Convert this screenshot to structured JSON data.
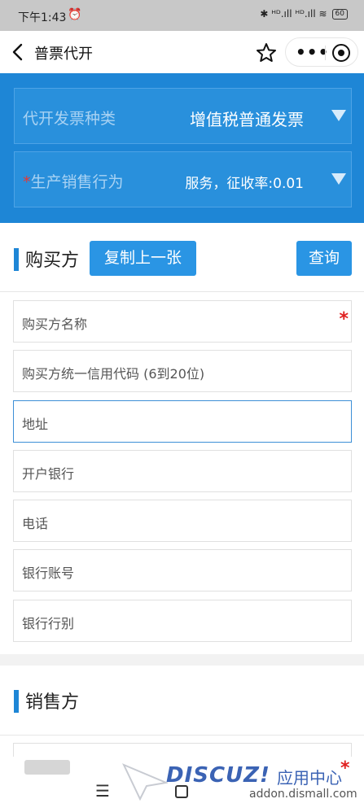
{
  "status_bar": {
    "time": "下午1:43",
    "alarm_icon": "alarm-clock-icon",
    "signals": "✱ ᴴᴰ.ıll ᴴᴰ.ıll ≋",
    "battery": "60"
  },
  "nav": {
    "title": "普票代开",
    "back_icon": "chevron-left-icon",
    "star_icon": "star-outline-icon",
    "more_label": "•••",
    "target_icon": "target-circle-icon"
  },
  "invoice_settings": {
    "type_label": "代开发票种类",
    "type_value": "增值税普通发票",
    "behavior_required": "*",
    "behavior_label": "生产销售行为",
    "behavior_value": "服务，征收率:0.01"
  },
  "buyer": {
    "title": "购买方",
    "copy_button": "复制上一张",
    "query_button": "查询",
    "required_mark": "*",
    "fields": [
      "购买方名称",
      "购买方统一信用代码 (6到20位)",
      "地址",
      "开户银行",
      "电话",
      "银行账号",
      "银行行别"
    ]
  },
  "seller": {
    "title": "销售方",
    "required_mark": "*"
  },
  "watermark": {
    "logo": "DISCUZ!",
    "cn": "应用中心",
    "url": "addon.dismall.com"
  },
  "system_nav": {
    "menu_icon": "☰",
    "home_icon": "square-home-icon"
  },
  "colors": {
    "header_blue": "#1e86d6",
    "button_blue": "#2a95e4",
    "required_red": "#e02020"
  }
}
